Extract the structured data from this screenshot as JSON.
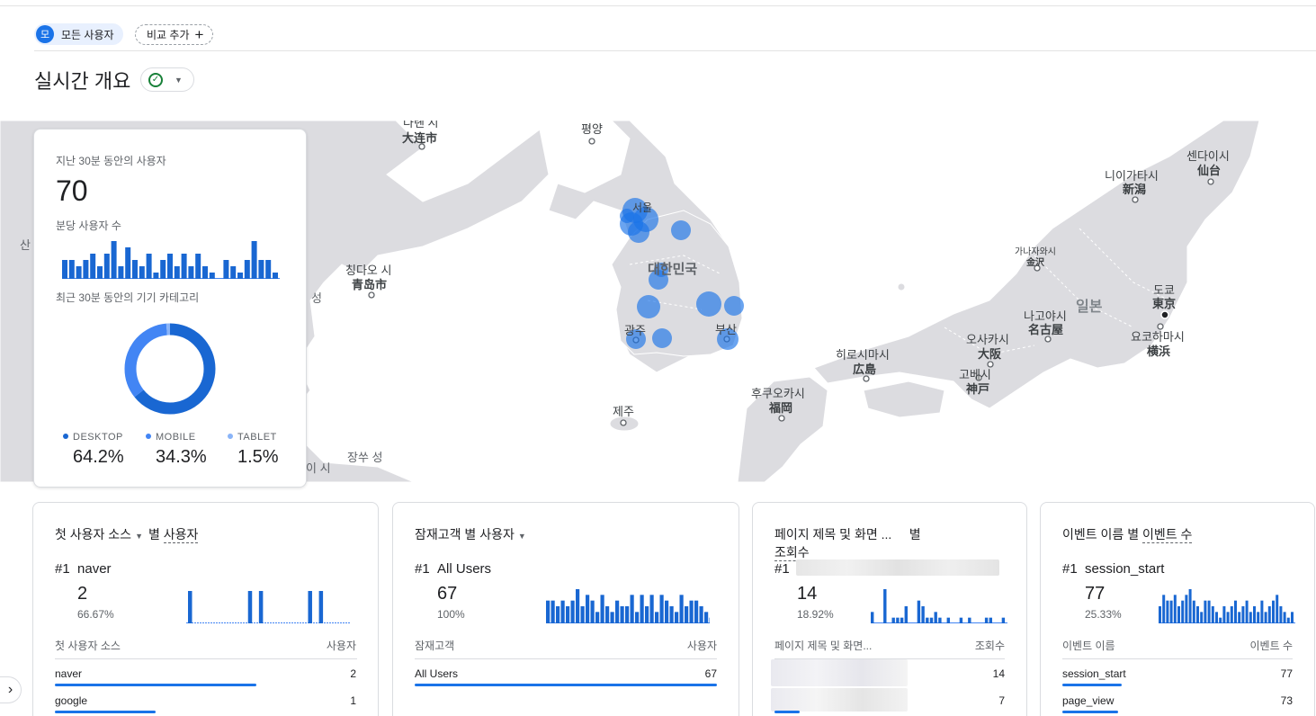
{
  "segment": {
    "avatar": "모",
    "label": "모든 사용자",
    "compare": "비교 추가",
    "plus": "+"
  },
  "page": {
    "title": "실시간 개요"
  },
  "map": {
    "labels": [
      {
        "key": "pyongyang",
        "text": "평양"
      },
      {
        "key": "dalian_ko",
        "text": "다롄 시"
      },
      {
        "key": "dalian",
        "text": "大连市"
      },
      {
        "key": "qingdao_ko",
        "text": "칭다오 시"
      },
      {
        "key": "qingdao",
        "text": "青岛市"
      },
      {
        "key": "korea",
        "text": "대한민국"
      },
      {
        "key": "seoul",
        "text": "서울"
      },
      {
        "key": "gwangju",
        "text": "광주"
      },
      {
        "key": "busan",
        "text": "부산"
      },
      {
        "key": "jeju",
        "text": "제주"
      },
      {
        "key": "fukuoka_ko",
        "text": "후쿠오카시"
      },
      {
        "key": "fukuoka",
        "text": "福岡"
      },
      {
        "key": "hiroshima_ko",
        "text": "히로시마시"
      },
      {
        "key": "hiroshima",
        "text": "広島"
      },
      {
        "key": "osaka_ko",
        "text": "오사카시"
      },
      {
        "key": "osaka",
        "text": "大阪"
      },
      {
        "key": "kobe_ko",
        "text": "고베시"
      },
      {
        "key": "kobe",
        "text": "神戸"
      },
      {
        "key": "nagoya_ko",
        "text": "나고야시"
      },
      {
        "key": "nagoya",
        "text": "名古屋"
      },
      {
        "key": "japan",
        "text": "일본"
      },
      {
        "key": "tokyo_ko",
        "text": "도쿄"
      },
      {
        "key": "tokyo",
        "text": "東京"
      },
      {
        "key": "yokohama_ko",
        "text": "요코하마시"
      },
      {
        "key": "yokohama",
        "text": "横浜"
      },
      {
        "key": "kanazawa_ko",
        "text": "가나자와시"
      },
      {
        "key": "kanazawa",
        "text": "金沢"
      },
      {
        "key": "niigata_ko",
        "text": "니이가타시"
      },
      {
        "key": "niigata",
        "text": "新潟"
      },
      {
        "key": "sendai_ko",
        "text": "센다이시"
      },
      {
        "key": "sendai",
        "text": "仙台"
      },
      {
        "key": "zhejiang",
        "text": "장쑤 성"
      },
      {
        "key": "shandong",
        "text": "성"
      },
      {
        "key": "edge_left",
        "text": "산"
      },
      {
        "key": "edge_bottom",
        "text": "이 시"
      }
    ]
  },
  "overview": {
    "users_label": "지난 30분 동안의 사용자",
    "users_value": "70",
    "per_minute_label": "분당 사용자 수",
    "device_label": "최근 30분 동안의 기기 카테고리",
    "per_minute": [
      3,
      3,
      2,
      3,
      4,
      2,
      4,
      6,
      2,
      5,
      3,
      2,
      4,
      1,
      3,
      4,
      2,
      4,
      2,
      4,
      2,
      1,
      0,
      3,
      2,
      1,
      3,
      6,
      3,
      3,
      1
    ],
    "devices": [
      {
        "name": "DESKTOP",
        "pct_label": "64.2%",
        "value": 64.2,
        "color": "#1967d2"
      },
      {
        "name": "MOBILE",
        "pct_label": "34.3%",
        "value": 34.3,
        "color": "#4285f4"
      },
      {
        "name": "TABLET",
        "pct_label": "1.5%",
        "value": 1.5,
        "color": "#8ab4f8"
      }
    ]
  },
  "cards": [
    {
      "dim_label": "첫 사용자 소스",
      "mid_label": "별",
      "metric_label": "사용자",
      "rank": "#1",
      "top_name": "naver",
      "top_value": "2",
      "top_pct": "66.67%",
      "col1": "첫 사용자 소스",
      "col2": "사용자",
      "rows": [
        {
          "name": "naver",
          "value": "2",
          "share": 1.0
        },
        {
          "name": "google",
          "value": "1",
          "share": 0.5
        }
      ],
      "spark": [
        0,
        0,
        0,
        0,
        0,
        0,
        0,
        0,
        0,
        0,
        0,
        0,
        0,
        0,
        0,
        0,
        0,
        0,
        0,
        0,
        0,
        0,
        0,
        0,
        0,
        0,
        0,
        0,
        0,
        0,
        0,
        0,
        0,
        0,
        0,
        0,
        0,
        0,
        0,
        0,
        0,
        0,
        0,
        0,
        0,
        0,
        0,
        0,
        0,
        0,
        0,
        0,
        0,
        0,
        0,
        0,
        0,
        0,
        0,
        0
      ]
    },
    {
      "dim_label": "잠재고객",
      "mid_label": "별",
      "metric_label": "사용자",
      "rank": "#1",
      "top_name": "All Users",
      "top_value": "67",
      "top_pct": "100%",
      "col1": "잠재고객",
      "col2": "사용자",
      "rows": [
        {
          "name": "All Users",
          "value": "67",
          "share": 1.0
        }
      ]
    },
    {
      "dim_label": "페이지 제목 및 화면 ...",
      "mid_label": "별",
      "metric_label": "조회수",
      "rank": "#1",
      "top_value": "14",
      "top_pct": "18.92%",
      "col1": "페이지 제목 및 화면...",
      "col2": "조회수",
      "rows": [
        {
          "value": "14",
          "share": 1.0
        },
        {
          "value": "7",
          "share": 0.5
        }
      ]
    },
    {
      "dim_label": "이벤트 이름",
      "mid_label": "별",
      "metric_label": "이벤트 수",
      "rank": "#1",
      "top_name": "session_start",
      "top_value": "77",
      "top_pct": "25.33%",
      "col1": "이벤트 이름",
      "col2": "이벤트 수",
      "rows": [
        {
          "name": "session_start",
          "value": "77",
          "share": 1.0
        },
        {
          "name": "page_view",
          "value": "73",
          "share": 0.95
        }
      ]
    }
  ],
  "sparks": {
    "source": [
      0,
      0,
      0,
      0,
      0,
      0,
      0,
      0,
      0,
      0,
      0,
      0,
      0,
      0,
      0,
      0,
      0,
      0,
      0,
      0,
      0,
      0,
      0,
      0,
      0,
      0,
      0,
      0,
      0,
      0
    ],
    "audience": [
      4,
      4,
      3,
      4,
      3,
      4,
      6,
      3,
      5,
      4,
      2,
      5,
      3,
      2,
      4,
      3,
      3,
      5,
      2,
      5,
      3,
      5,
      2,
      5,
      4,
      3,
      2,
      5,
      3,
      4,
      4,
      3,
      2,
      1
    ],
    "pages": [
      2,
      0,
      0,
      6,
      0,
      1,
      1,
      1,
      3,
      0,
      0,
      4,
      3,
      1,
      1,
      2,
      1,
      0,
      1,
      0,
      0,
      1,
      0,
      1,
      0,
      0,
      0,
      1,
      1,
      0,
      0,
      1
    ],
    "events": [
      3,
      5,
      4,
      4,
      5,
      3,
      4,
      5,
      6,
      4,
      3,
      2,
      4,
      4,
      3,
      2,
      1,
      3,
      2,
      3,
      4,
      2,
      3,
      4,
      2,
      3,
      2,
      4,
      2,
      3,
      4,
      5,
      3,
      2,
      1,
      2
    ],
    "source_spikes": [
      [
        0,
        1
      ],
      [
        11,
        1
      ],
      [
        13,
        1
      ],
      [
        22,
        1
      ],
      [
        24,
        1
      ]
    ]
  }
}
